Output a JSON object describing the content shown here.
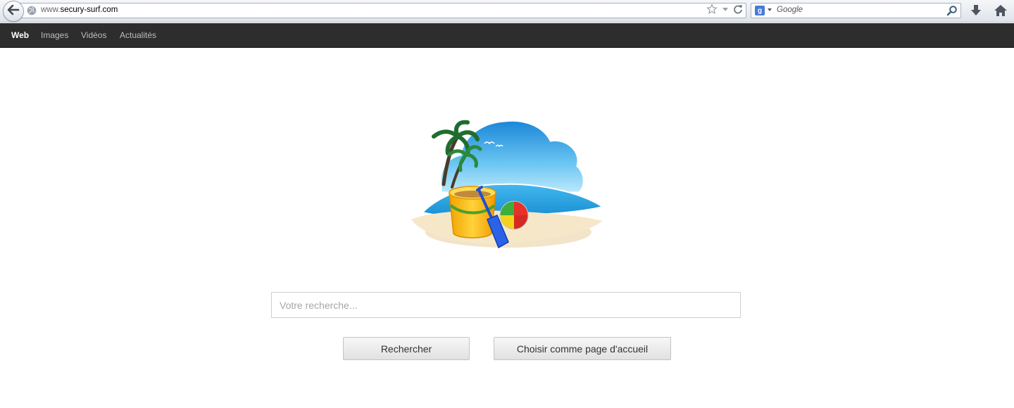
{
  "browser": {
    "url_prefix": "www.",
    "url_domain": "secury-surf.com",
    "search_engine": "Google",
    "search_engine_logo": "g"
  },
  "nav": {
    "items": [
      {
        "label": "Web",
        "active": true
      },
      {
        "label": "Images",
        "active": false
      },
      {
        "label": "Vidéos",
        "active": false
      },
      {
        "label": "Actualités",
        "active": false
      }
    ]
  },
  "search": {
    "placeholder": "Votre recherche...",
    "value": "",
    "search_button": "Rechercher",
    "homepage_button": "Choisir comme page d'accueil"
  },
  "icons": {
    "back": "back-arrow-icon",
    "globe": "globe-icon",
    "star": "star-icon",
    "dropdown": "chevron-down-icon",
    "reload": "reload-icon",
    "magnifier": "search-icon",
    "download": "download-icon",
    "home": "home-icon"
  },
  "colors": {
    "navbar_bg": "#2d2d2d",
    "nav_active": "#ffffff",
    "nav_inactive": "#bdbdbd",
    "sky": "#2fa3e6",
    "sea": "#1b9ad6",
    "sand": "#f3e3c3"
  }
}
